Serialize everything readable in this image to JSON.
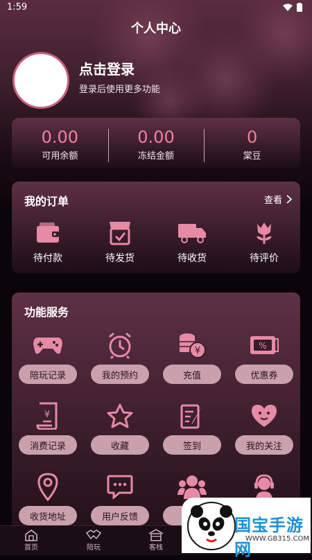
{
  "status": {
    "time": "1:59"
  },
  "header": {
    "title": "个人中心"
  },
  "profile": {
    "login_title": "点击登录",
    "login_subtitle": "登录后使用更多功能"
  },
  "stats": [
    {
      "value": "0.00",
      "label": "可用余额"
    },
    {
      "value": "0.00",
      "label": "冻结金额"
    },
    {
      "value": "0",
      "label": "棠豆"
    }
  ],
  "orders": {
    "title": "我的订单",
    "more": "查看",
    "items": [
      {
        "label": "待付款",
        "icon": "wallet-icon"
      },
      {
        "label": "待发货",
        "icon": "shop-icon"
      },
      {
        "label": "待收货",
        "icon": "truck-icon"
      },
      {
        "label": "待评价",
        "icon": "flower-icon"
      }
    ]
  },
  "services": {
    "title": "功能服务",
    "items": [
      {
        "label": "陪玩记录",
        "icon": "gamepad-icon"
      },
      {
        "label": "我的预约",
        "icon": "alarm-clock-icon"
      },
      {
        "label": "充值",
        "icon": "coins-icon"
      },
      {
        "label": "优惠券",
        "icon": "coupon-icon"
      },
      {
        "label": "消费记录",
        "icon": "receipt-icon"
      },
      {
        "label": "收藏",
        "icon": "star-icon"
      },
      {
        "label": "签到",
        "icon": "signin-icon"
      },
      {
        "label": "我的关注",
        "icon": "heart-icon"
      },
      {
        "label": "收货地址",
        "icon": "location-icon"
      },
      {
        "label": "用户反馈",
        "icon": "chat-icon"
      },
      {
        "label": "",
        "icon": "group-icon"
      },
      {
        "label": "",
        "icon": "support-icon"
      }
    ]
  },
  "tabbar": [
    {
      "label": "首页",
      "icon": "home-icon"
    },
    {
      "label": "陪玩",
      "icon": "handshake-icon"
    },
    {
      "label": "客栈",
      "icon": "inn-icon"
    }
  ],
  "watermark": {
    "text": "国宝手游网",
    "url": "WWW.GB315.COM"
  },
  "colors": {
    "accent": "#f27fa0",
    "icon": "#e68aa6",
    "pill": "#caa0ad"
  }
}
